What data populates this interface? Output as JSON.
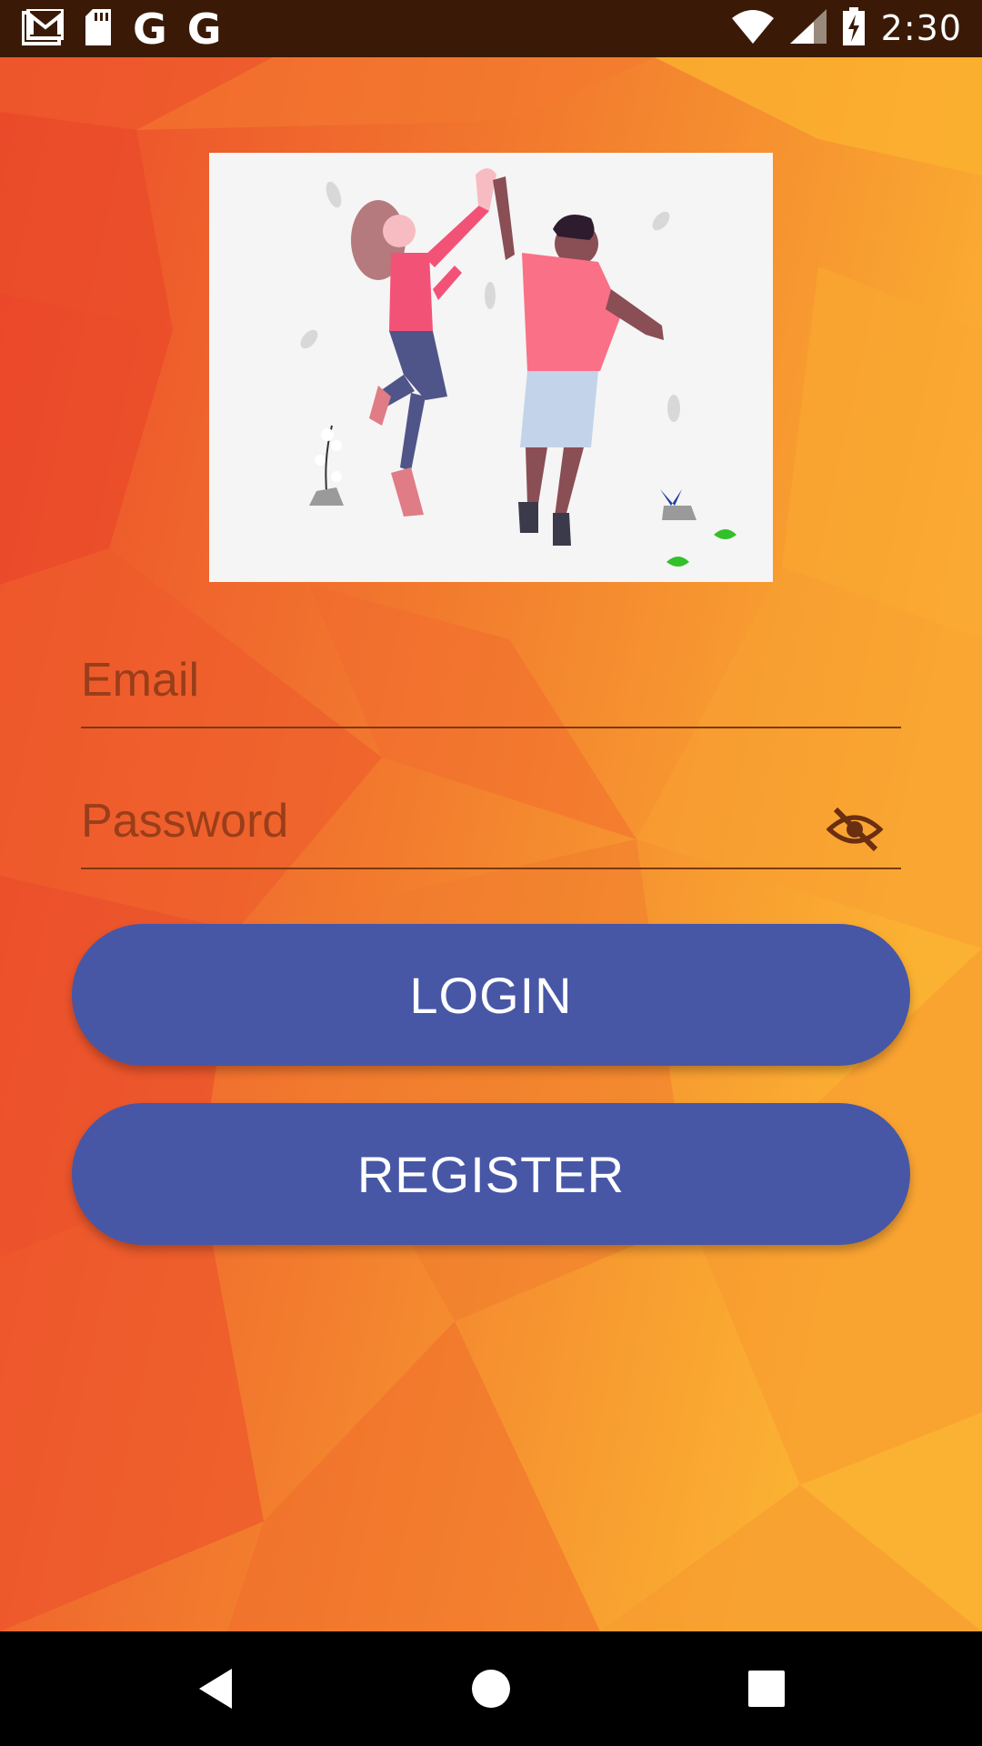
{
  "status_bar": {
    "time": "2:30",
    "left_icons": [
      "gmail-icon",
      "sd-card-icon",
      "google-icon",
      "google-icon"
    ],
    "right_icons": [
      "wifi-icon",
      "signal-icon",
      "battery-charging-icon"
    ]
  },
  "hero": {
    "icon": "high-five-illustration"
  },
  "form": {
    "email_placeholder": "Email",
    "email_value": "",
    "password_placeholder": "Password",
    "password_value": "",
    "password_toggle_icon": "eye-off-icon"
  },
  "buttons": {
    "login_label": "LOGIN",
    "register_label": "REGISTER"
  },
  "nav_bar": {
    "icons": [
      "back-icon",
      "home-icon",
      "recents-icon"
    ]
  },
  "colors": {
    "accent": "#4757a6",
    "status_bar": "#3a1a06",
    "background_orange": "#f07a2c",
    "field_underline": "#7a3a10"
  }
}
